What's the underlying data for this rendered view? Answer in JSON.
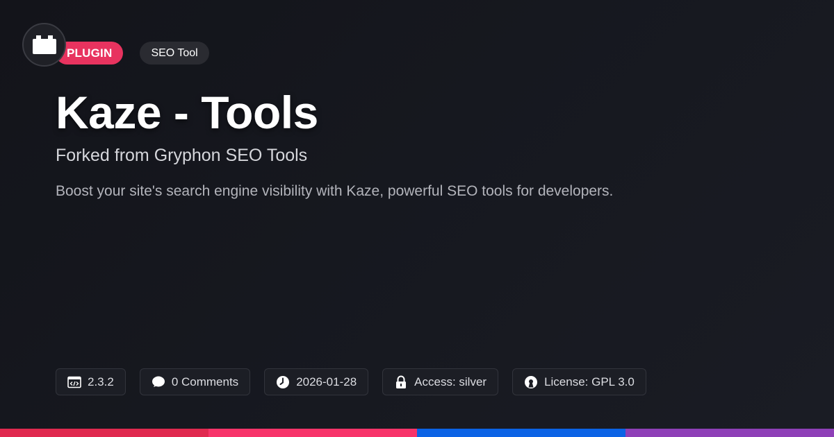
{
  "logo": {
    "icon": "plugin-block-icon"
  },
  "badges": {
    "type_label": "PLUGIN",
    "category_label": "SEO Tool"
  },
  "title": "Kaze - Tools",
  "subtitle": "Forked from Gryphon SEO Tools",
  "description": "Boost your site's search engine visibility with Kaze, powerful SEO tools for developers.",
  "meta": {
    "version": "2.3.2",
    "comments": "0 Comments",
    "date": "2026-01-28",
    "access": "Access: silver",
    "license": "License: GPL 3.0"
  },
  "colors": {
    "accent_pink": "#e8335f",
    "bar": [
      "#e0294f",
      "#f7346a",
      "#0b63e5",
      "#8e3fb7"
    ]
  }
}
